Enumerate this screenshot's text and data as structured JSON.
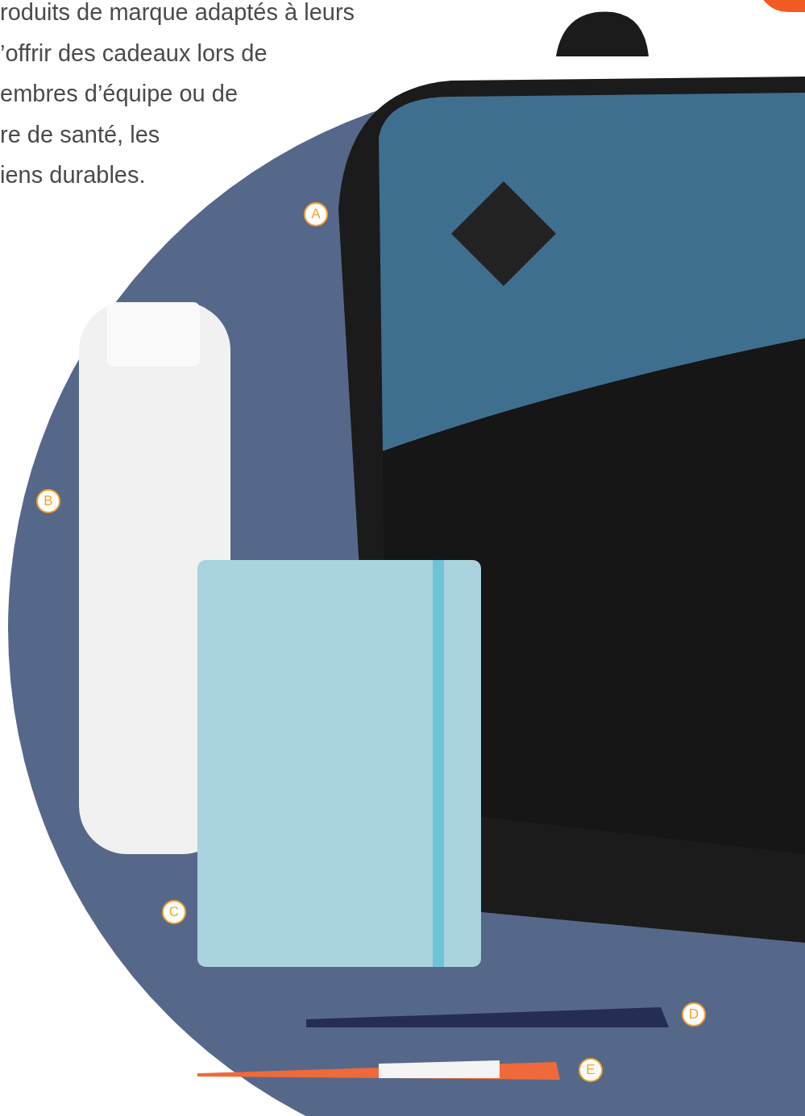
{
  "paragraph_lines": [
    "roduits de marque adaptés à leurs",
    "’offrir des cadeaux lors de",
    "embres d’équipe ou de",
    "re de santé, les",
    "iens durables."
  ],
  "markers": [
    {
      "label": "A"
    },
    {
      "label": "B"
    },
    {
      "label": "C"
    },
    {
      "label": "D"
    },
    {
      "label": "E"
    }
  ]
}
